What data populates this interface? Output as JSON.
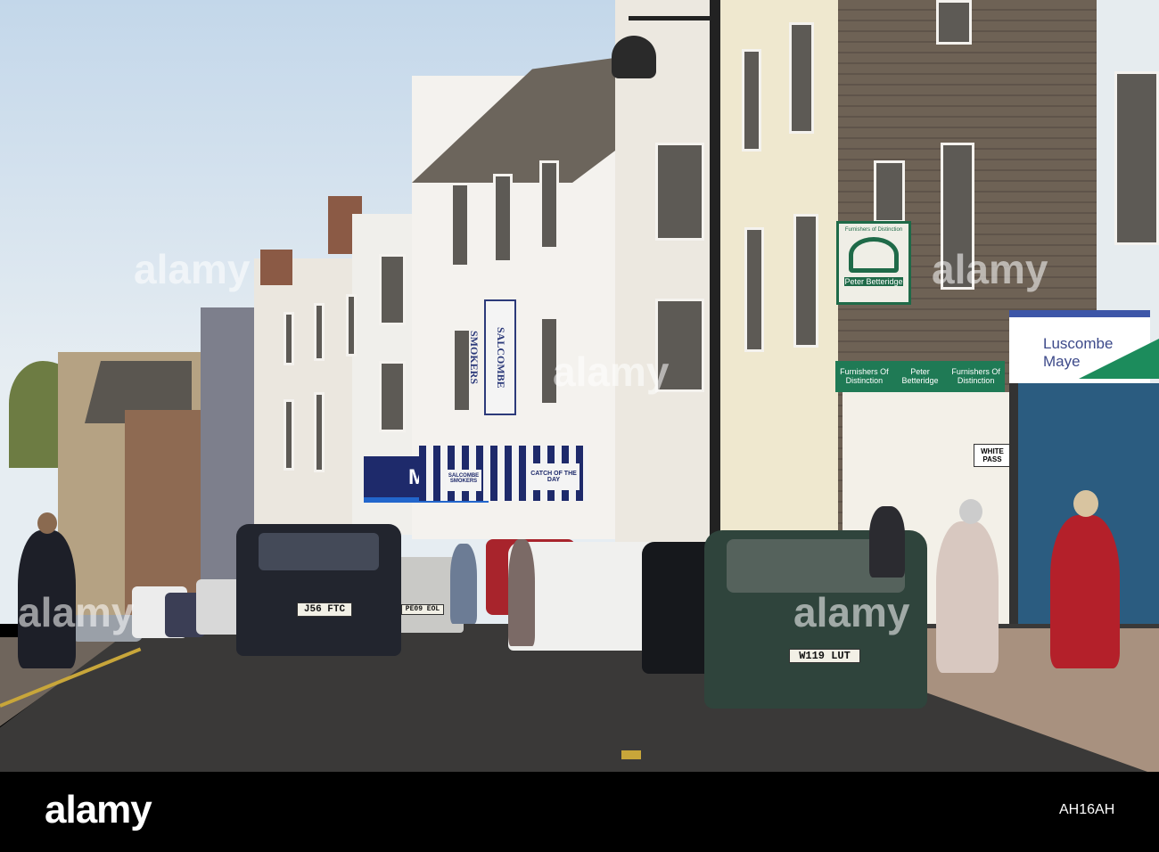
{
  "watermark": {
    "logo": "alamy",
    "image_code": "AH16AH",
    "overlay": "alamy"
  },
  "signs": {
    "smokers_vertical": "SALCOMBE SMOKERS",
    "hanging_top": "Furnishers of Distinction",
    "hanging_name": "Peter Betteridge",
    "fascia_1": "Furnishers Of Distinction",
    "fascia_2": "Peter Betteridge",
    "fascia_3": "Furnishers Of Distinction",
    "agent": "Luscombe Maye",
    "shop_fascia": "Ma",
    "awning_left": "SALCOMBE SMOKERS",
    "awning_right": "CATCH OF THE DAY",
    "street_sign": "WHITE PASS"
  },
  "plates": {
    "suv": "J56 FTC",
    "silver": "PE09 EOL",
    "green": "W119 LUT"
  },
  "colors": {
    "sky": "#c3d7ea",
    "road": "#3a3938",
    "slate": "#6e6255",
    "green_sign": "#1f7a55",
    "navy": "#1e2a6b"
  }
}
